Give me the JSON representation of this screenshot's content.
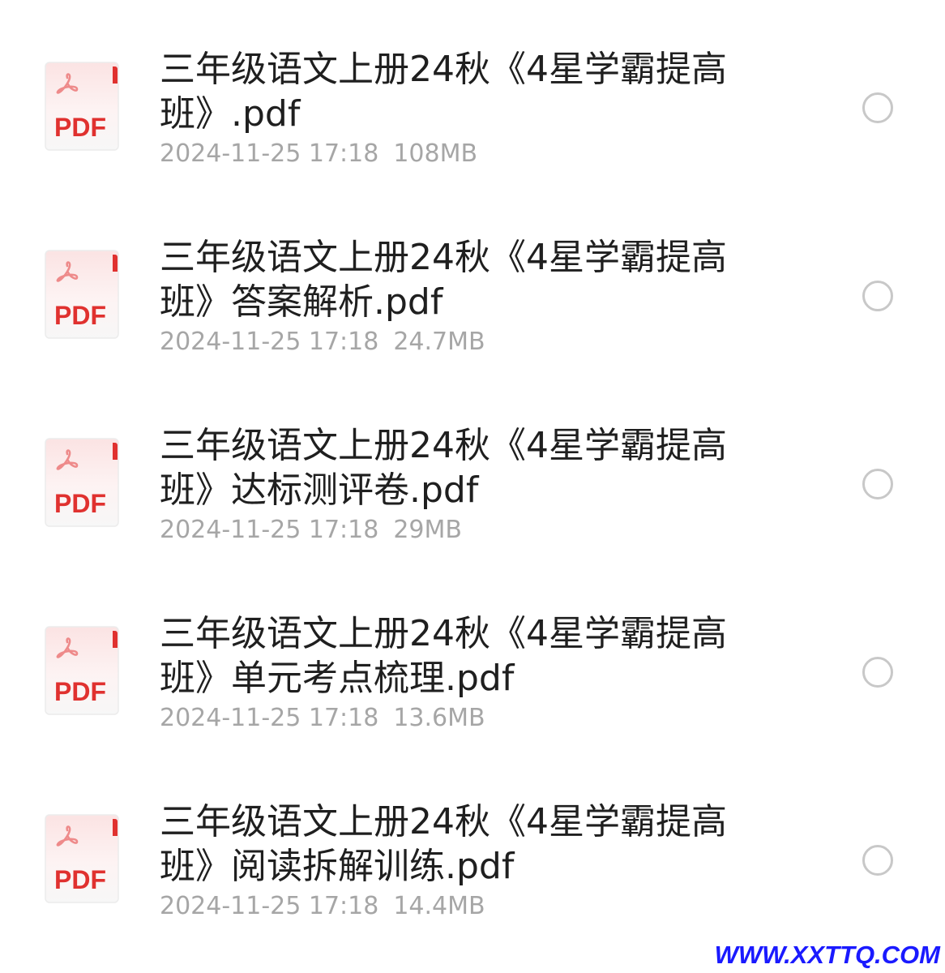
{
  "colors": {
    "background": "#ffffff",
    "name_text": "#1f1f1f",
    "meta_text": "#a6a6a6",
    "pdf_red": "#e0312f",
    "radio_border": "#c8c8c8",
    "watermark": "#1a1aff"
  },
  "files": [
    {
      "name": "三年级语文上册24秋《4星学霸提高班》.pdf",
      "date": "2024-11-25 17:18",
      "size": "108MB",
      "icon": "pdf-file-icon",
      "icon_label": "PDF",
      "selected": false
    },
    {
      "name": "三年级语文上册24秋《4星学霸提高班》答案解析.pdf",
      "date": "2024-11-25 17:18",
      "size": "24.7MB",
      "icon": "pdf-file-icon",
      "icon_label": "PDF",
      "selected": false
    },
    {
      "name": "三年级语文上册24秋《4星学霸提高班》达标测评卷.pdf",
      "date": "2024-11-25 17:18",
      "size": "29MB",
      "icon": "pdf-file-icon",
      "icon_label": "PDF",
      "selected": false
    },
    {
      "name": "三年级语文上册24秋《4星学霸提高班》单元考点梳理.pdf",
      "date": "2024-11-25 17:18",
      "size": "13.6MB",
      "icon": "pdf-file-icon",
      "icon_label": "PDF",
      "selected": false
    },
    {
      "name": "三年级语文上册24秋《4星学霸提高班》阅读拆解训练.pdf",
      "date": "2024-11-25 17:18",
      "size": "14.4MB",
      "icon": "pdf-file-icon",
      "icon_label": "PDF",
      "selected": false
    }
  ],
  "watermark": "WWW.XXTTQ.COM"
}
